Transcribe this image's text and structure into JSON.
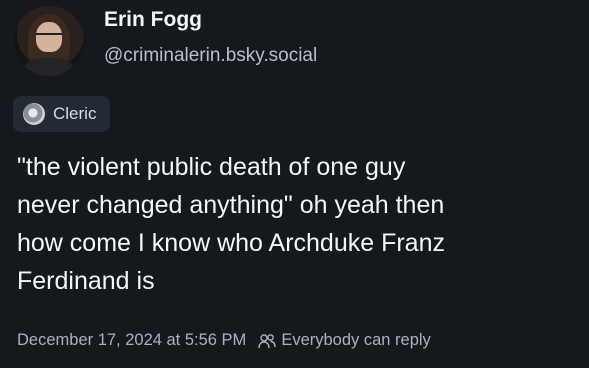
{
  "author": {
    "display_name": "Erin Fogg",
    "handle": "@criminalerin.bsky.social",
    "avatar_icon": "avatar-photo"
  },
  "badge": {
    "label": "Cleric",
    "icon": "cleric-badge-icon"
  },
  "post": {
    "text": "\"the violent public death of one guy\nnever changed anything\" oh yeah then\nhow come I know who Archduke Franz\nFerdinand is"
  },
  "footer": {
    "timestamp": "December 17, 2024 at 5:56 PM",
    "reply_setting": "Everybody can reply",
    "reply_icon": "people-icon"
  },
  "colors": {
    "background": "#15191e",
    "badge_background": "#232a33",
    "primary_text": "#f4f5f7",
    "secondary_text": "#aab2bc"
  }
}
